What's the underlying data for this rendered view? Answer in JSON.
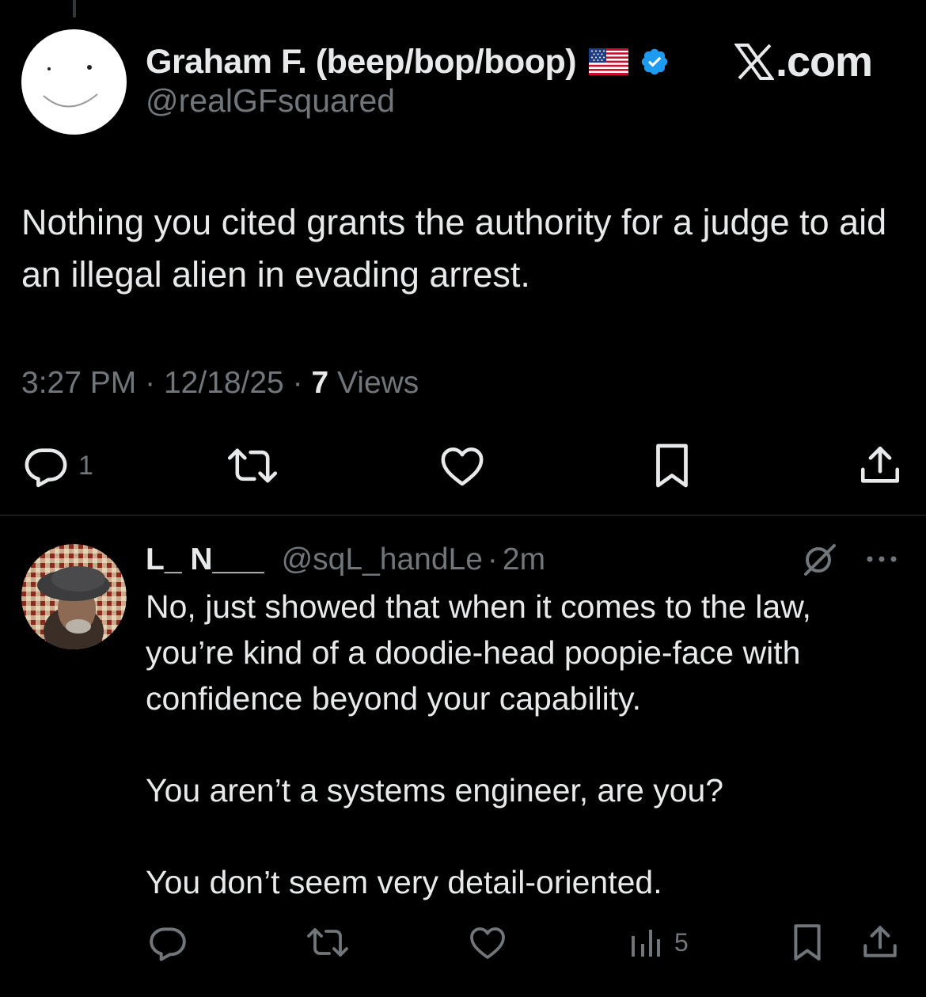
{
  "tweet": {
    "author_name": "Graham F. (beep/bop/boop)",
    "handle": "@realGFsquared",
    "brand": ".com",
    "text": "Nothing you cited grants the authority for a judge to aid an illegal alien in evading arrest.",
    "time": "3:27 PM",
    "date": "12/18/25",
    "views_count": "7",
    "views_label": "Views",
    "separator": "·",
    "actions": {
      "reply_count": "1",
      "icons": [
        "reply-icon",
        "retweet-icon",
        "like-icon",
        "bookmark-icon",
        "share-icon"
      ]
    }
  },
  "reply": {
    "author_name": "L_ N___",
    "handle": "@sqL_handLe",
    "separator": "·",
    "time_ago": "2m",
    "paragraphs": [
      "No, just showed that when it comes to the law, you’re kind of a doodie-head poopie-face with confidence beyond your capability.",
      "You aren’t a systems engineer, are you?",
      "You don’t seem very detail-oriented."
    ],
    "actions": {
      "views_count": "5",
      "icons": [
        "reply-icon",
        "retweet-icon",
        "like-icon",
        "views-icon",
        "bookmark-icon",
        "share-icon"
      ]
    }
  },
  "colors": {
    "background": "#000000",
    "text": "#e7e9ea",
    "muted": "#71767b",
    "divider": "#2f3336",
    "verified": "#1d9bf0"
  }
}
